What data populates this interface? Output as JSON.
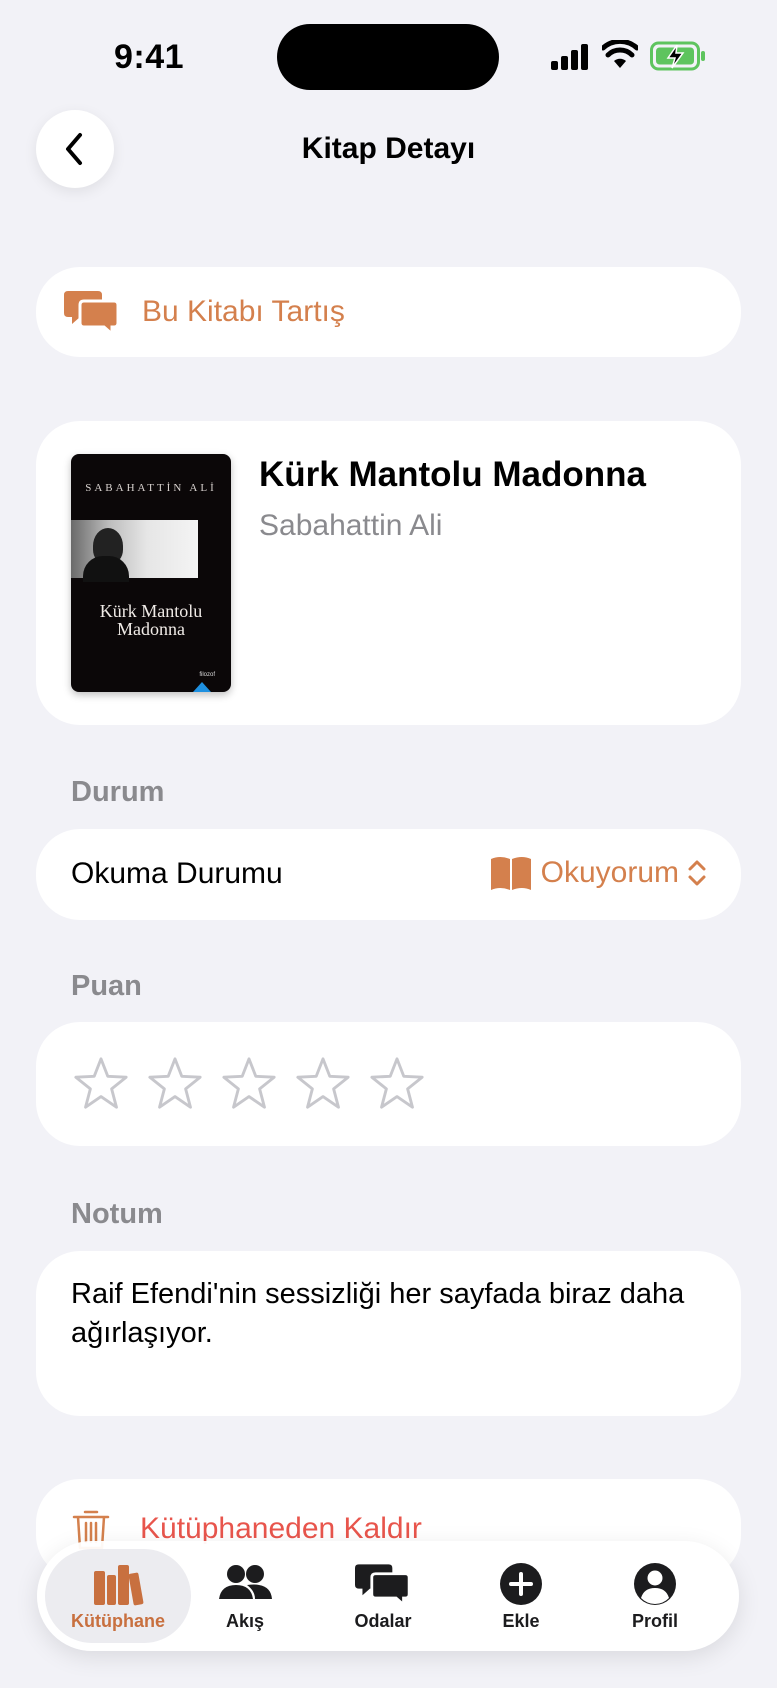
{
  "status_bar": {
    "time": "9:41"
  },
  "nav": {
    "title": "Kitap Detayı"
  },
  "discuss": {
    "label": "Bu Kitabı Tartış"
  },
  "book": {
    "title": "Kürk Mantolu Madonna",
    "author": "Sabahattin Ali",
    "cover": {
      "author_text": "SABAHATTİN ALİ",
      "title_line1": "Kürk Mantolu",
      "title_line2": "Madonna",
      "publisher": "filozof"
    }
  },
  "status_section": {
    "label": "Durum",
    "row_label": "Okuma Durumu",
    "value": "Okuyorum",
    "icon": "book-open-icon"
  },
  "rating_section": {
    "label": "Puan",
    "stars": 5,
    "rating": 0
  },
  "note_section": {
    "label": "Notum",
    "text": "Raif Efendi'nin sessizliği her sayfada biraz daha ağırlaşıyor."
  },
  "remove": {
    "label": "Kütüphaneden Kaldır"
  },
  "tabs": [
    {
      "label": "Kütüphane",
      "icon": "books-icon",
      "active": true
    },
    {
      "label": "Akış",
      "icon": "people-icon",
      "active": false
    },
    {
      "label": "Odalar",
      "icon": "chat-bubbles-icon",
      "active": false
    },
    {
      "label": "Ekle",
      "icon": "plus-circle-icon",
      "active": false
    },
    {
      "label": "Profil",
      "icon": "person-circle-icon",
      "active": false
    }
  ],
  "colors": {
    "accent": "#d4804d",
    "destructive": "#e8554c",
    "background": "#f2f2f7"
  }
}
